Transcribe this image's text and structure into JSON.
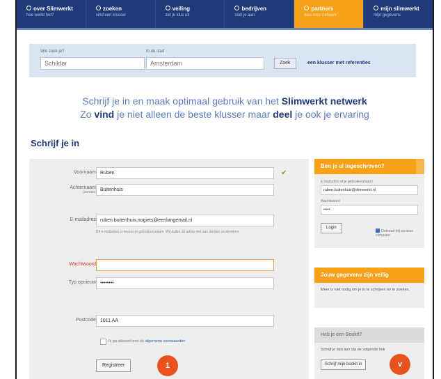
{
  "nav": {
    "items": [
      {
        "title": "over Slimwerkt",
        "sub": "hoe werkt het?"
      },
      {
        "title": "zoeken",
        "sub": "vind een klusser"
      },
      {
        "title": "veiling",
        "sub": "zet je klus uit"
      },
      {
        "title": "bedrijven",
        "sub": "sluit je aan"
      },
      {
        "title": "partners",
        "sub": "kies voor netwerk"
      },
      {
        "title": "mijn slimwerkt",
        "sub": "mijn gegevens"
      }
    ],
    "active_index": 4
  },
  "search": {
    "label_what": "Wie zoek je?",
    "label_where": "In de stad",
    "placeholder_what": "Schilder",
    "placeholder_where": "Amsterdam",
    "button": "Zoek",
    "link": "een klusser met referenties"
  },
  "intro": {
    "line1_pre": "Schrijf je in en maak optimaal gebruik van het ",
    "line1_bold": "Slimwerkt netwerk",
    "line2_pre": "Zo ",
    "line2_bold1": "vind",
    "line2_mid": " je niet alleen de beste klusser maar ",
    "line2_bold2": "deel",
    "line2_post": " je ook je ervaring"
  },
  "signup": {
    "title": "Schrijf je in",
    "first_name_label": "Voornaam",
    "first_name_value": "Ruben",
    "last_name_label": "Achternaam",
    "last_name_sub": "(zonder)",
    "last_name_value": "Buitenhuis",
    "email_label": "E-mailadres",
    "email_value": "ruben.buitenhuis.nogiets@eenlangemail.nl",
    "email_hint": "Dit e-mailadres is tevens je gebruikersnaam. Wij zullen dit adres niet aan derden verstrekken.",
    "password_label": "Wachtwoord",
    "password_value": "",
    "repeat_label": "Typ opnieuw",
    "repeat_value": "••••••••",
    "postcode_label": "Postcode",
    "postcode_value": "1011 AA",
    "terms_pre": "Ik ga akkoord met de ",
    "terms_link": "algemene voorwaarden",
    "submit": "Registreer",
    "badge_1": "1",
    "badge_2": "v"
  },
  "login": {
    "title": "Ben je al ingeschreven?",
    "email_label": "E-mailadres of je gebruikersnaam",
    "email_value": "ruben.buitenhuis@slimwerkt.nl",
    "password_label": "Wachtwoord",
    "password_value": "•••••",
    "button": "Login",
    "remember": "Onthoud mij op deze computer"
  },
  "partner": {
    "title": "Jouw gegevens zijn veilig",
    "text": "Meer is niet nodig om je in te schrijven en te zoeken."
  },
  "bookit": {
    "title": "Heb je een BookIt?",
    "text": "Schrijf je dan aan via de volgende link",
    "button": "Schrijf mijn bookit in"
  }
}
